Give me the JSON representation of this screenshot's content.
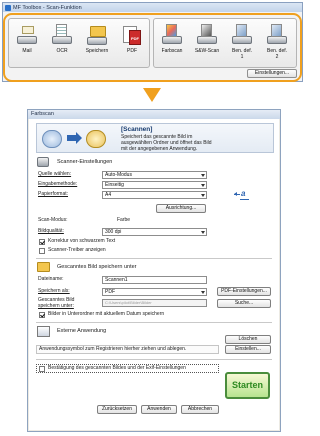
{
  "toolbox": {
    "title": "MF Toolbox - Scan-Funktion",
    "tools_left": [
      {
        "label": "Mail",
        "icon": "mail-icon"
      },
      {
        "label": "OCR",
        "icon": "ocr-icon"
      },
      {
        "label": "Speichern",
        "icon": "save-icon"
      },
      {
        "label": "PDF",
        "icon": "pdf-icon"
      }
    ],
    "tools_right": [
      {
        "label": "Farbscan",
        "icon": "color-scan-icon"
      },
      {
        "label": "S&W-Scan",
        "icon": "bw-scan-icon"
      },
      {
        "label": "Ben. def.",
        "label2": "1",
        "icon": "custom-1-icon"
      },
      {
        "label": "Ben. def.",
        "label2": "2",
        "icon": "custom-2-icon"
      }
    ],
    "extensions_button": "Einstellungen..."
  },
  "arrow": {
    "color": "#f0a01e"
  },
  "dialog": {
    "title": "Farbscan",
    "header": {
      "title": "[Scannen]",
      "description": [
        "Speichert das gescannte Bild im",
        "ausgewählten Ordner und öffnet das Bild",
        "mit der angegebenen Anwendung."
      ]
    },
    "scanner_settings": {
      "section_title": "Scanner-Einstellungen",
      "source_label": "Quelle wählen:",
      "source_value": "Auto-Modus",
      "input_method_label": "Eingabemethode:",
      "input_method_value": "Einseitig",
      "paper_format_label": "Papierformat:",
      "paper_format_value": "A4",
      "orientation_button": "Ausrichtung...",
      "scan_mode_label": "Scan-Modus:",
      "scan_mode_value": "Farbe",
      "image_quality_label": "Bildqualität:",
      "image_quality_value": "300 dpi",
      "correct_black_text_label": "Korrektur von schwarzem Text",
      "correct_black_text_checked": true,
      "show_driver_label": "Scanner-Treiber anzeigen",
      "show_driver_checked": false
    },
    "save_settings": {
      "section_title": "Gescanntes Bild speichern unter",
      "file_name_label": "Dateiname:",
      "file_name_value": "Scannen1",
      "save_as_label": "Speichern als:",
      "save_as_value": "PDF",
      "pdf_settings_button": "PDF-Einstellungen...",
      "save_path_label_1": "Gescanntes Bild",
      "save_path_label_2": "speichern unter:",
      "save_path_value": "C:\\Users\\pilot\\Bilder\\Bilder",
      "browse_button": "Suche...",
      "subfolder_label": "Bilder in Unterordner mit aktuellem Datum speichern",
      "subfolder_checked": true
    },
    "external_app": {
      "section_title": "Externe Anwendung",
      "delete_button": "Löschen",
      "hint": "Anwendungssymbol zum Registrieren hierher ziehen und ablegen.",
      "settings_button": "Einstellen..."
    },
    "confirm_label": "Bestätigung des gescannten Bildes und der Exif-Einstellungen",
    "confirm_checked": false,
    "buttons": {
      "reset": "Zurücksetzen",
      "apply": "Anwenden",
      "cancel": "Abbrechen",
      "start": "Starten"
    }
  }
}
